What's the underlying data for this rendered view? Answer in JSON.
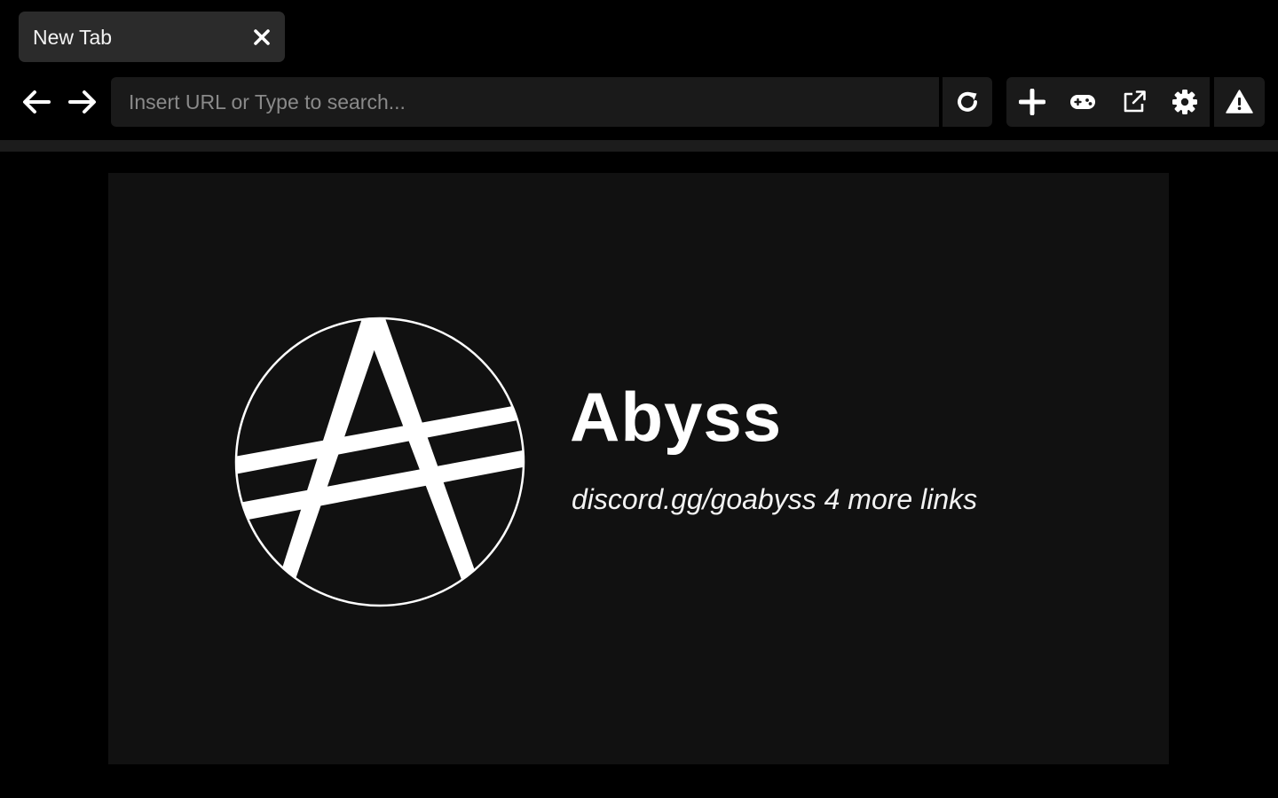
{
  "tabbar": {
    "tabs": [
      {
        "title": "New Tab",
        "close_icon": "close-icon"
      }
    ]
  },
  "toolbar": {
    "back_icon": "arrow-left-icon",
    "forward_icon": "arrow-right-icon",
    "url": {
      "value": "",
      "placeholder": "Insert URL or Type to search..."
    },
    "reload_icon": "reload-icon",
    "tools": [
      {
        "name": "new-tab",
        "icon": "plus-icon"
      },
      {
        "name": "games",
        "icon": "gamepad-icon"
      },
      {
        "name": "open-external",
        "icon": "external-link-icon"
      },
      {
        "name": "settings",
        "icon": "gear-icon"
      }
    ],
    "warning_icon": "warning-icon"
  },
  "main": {
    "logo_icon": "abyss-logo-icon",
    "title": "Abyss",
    "links_text": "discord.gg/goabyss 4 more links"
  },
  "colors": {
    "page_bg": "#000000",
    "tab_bg": "#2b2b2b",
    "toolbar_bg": "#1a1a1a",
    "content_bg": "#111111",
    "text": "#ffffff",
    "placeholder": "#8a8a8a"
  }
}
